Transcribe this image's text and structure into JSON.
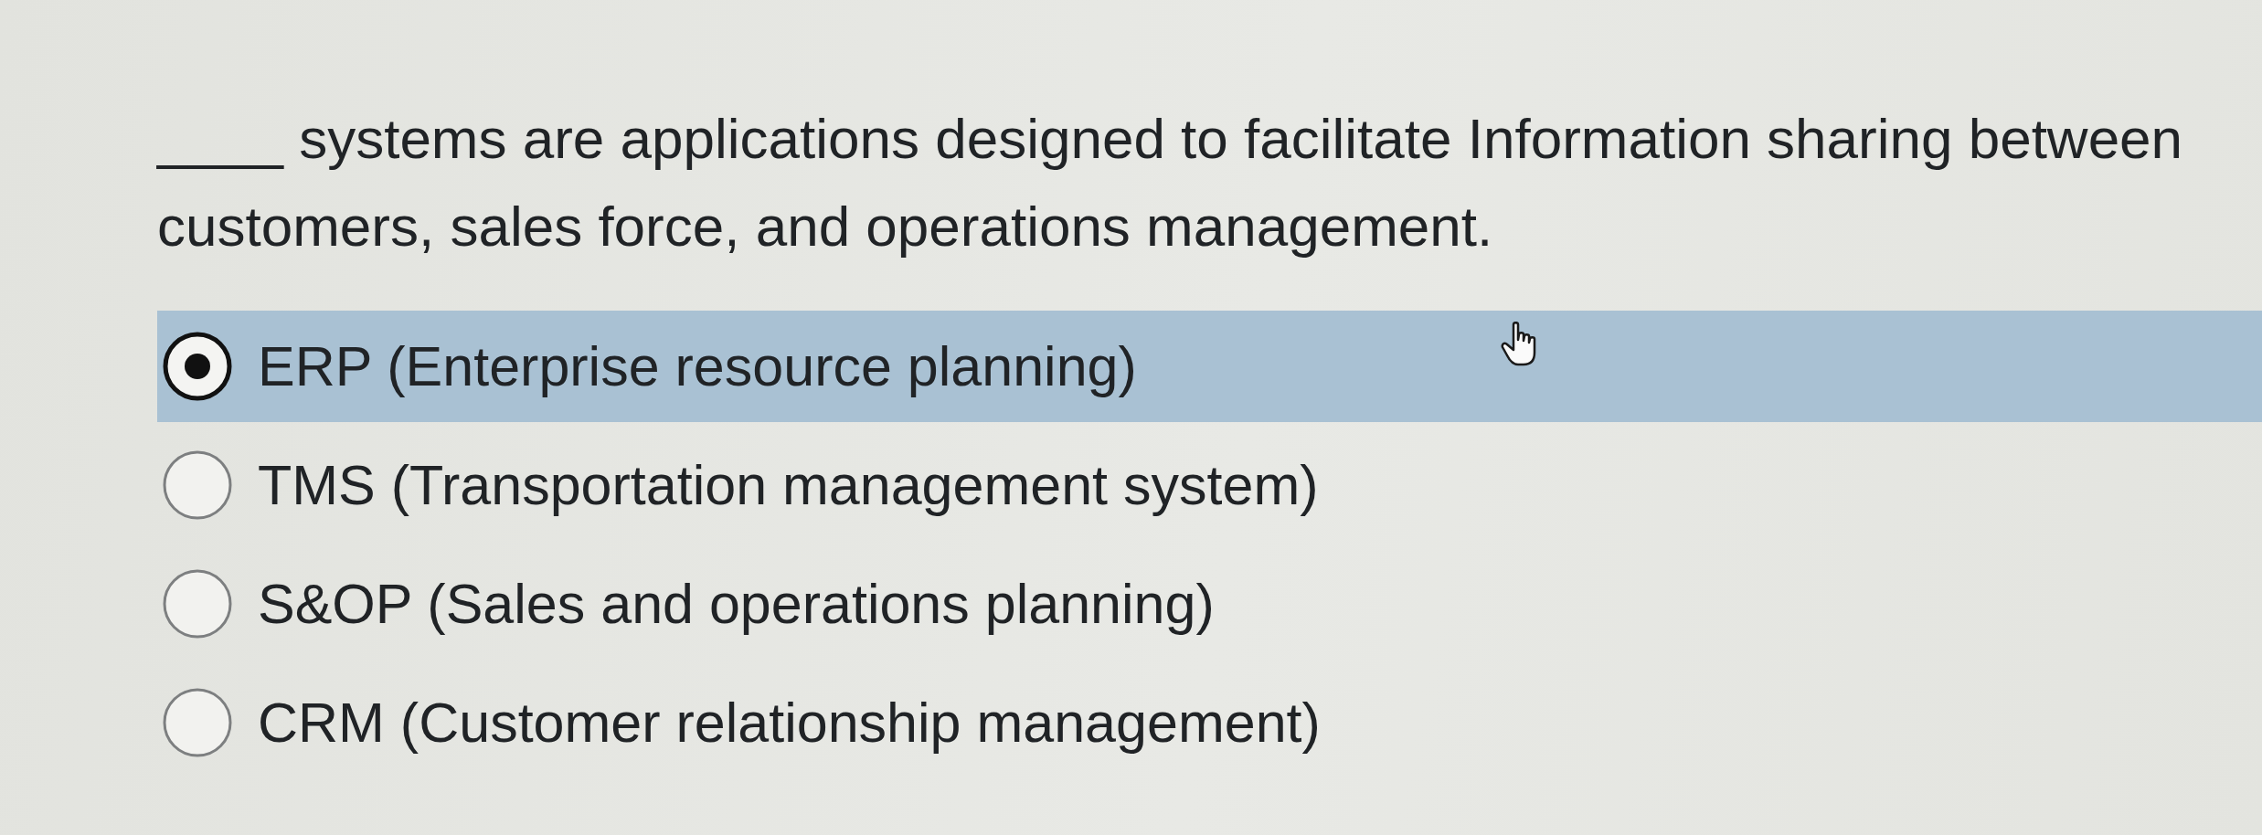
{
  "question": {
    "text": "____ systems are applications designed to facilitate Information sharing between customers, sales force, and operations management."
  },
  "options": [
    {
      "label": "ERP (Enterprise resource planning)",
      "selected": true
    },
    {
      "label": "TMS (Transportation management system)",
      "selected": false
    },
    {
      "label": "S&OP (Sales and operations planning)",
      "selected": false
    },
    {
      "label": "CRM (Customer relationship management)",
      "selected": false
    }
  ]
}
